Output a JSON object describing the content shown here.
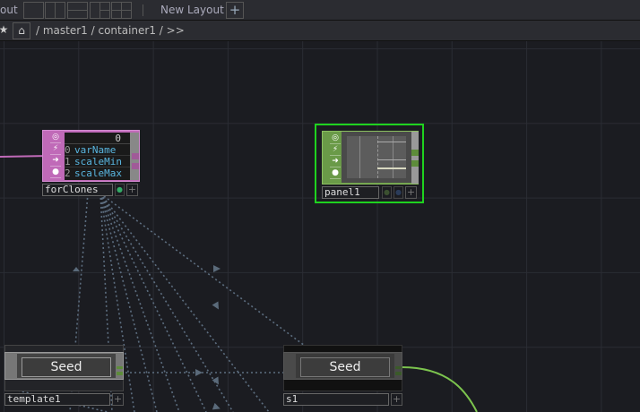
{
  "topbar": {
    "layout_label": "out",
    "new_layout_label": "New Layout",
    "add_icon": "+"
  },
  "breadcrumb": {
    "star_icon": "★",
    "home_icon": "⌂",
    "path": "/ master1 / container1 / >>"
  },
  "nodes": {
    "forClones": {
      "name": "forClones",
      "header_value": "0",
      "rows": [
        {
          "index": "0",
          "value": "varName"
        },
        {
          "index": "1",
          "value": "scaleMin"
        },
        {
          "index": "2",
          "value": "scaleMax"
        }
      ],
      "color": "#c06ab8"
    },
    "panel1": {
      "name": "panel1",
      "color": "#6a9a48",
      "selected_color": "#1fd21f"
    },
    "template1": {
      "name": "template1",
      "button_label": "Seed"
    },
    "s1": {
      "name": "s1",
      "button_label": "Seed"
    }
  },
  "plus_label": "+"
}
